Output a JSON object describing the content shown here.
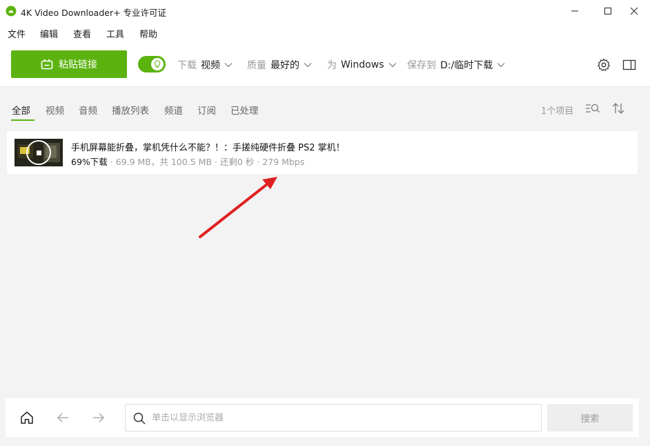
{
  "window": {
    "title": "4K Video Downloader+ 专业许可证"
  },
  "menu": [
    "文件",
    "编辑",
    "查看",
    "工具",
    "帮助"
  ],
  "toolbar": {
    "paste_label": "粘贴链接",
    "download_label": "下载",
    "download_value": "视频",
    "quality_label": "质量",
    "quality_value": "最好的",
    "for_label": "为",
    "for_value": "Windows",
    "save_label": "保存到",
    "save_value": "D:/临时下载"
  },
  "tabs": [
    "全部",
    "视频",
    "音频",
    "播放列表",
    "频道",
    "订阅",
    "已处理"
  ],
  "active_tab": "全部",
  "item_count": "1个项目",
  "download_item": {
    "title": "手机屏幕能折叠，掌机凭什么不能？！：手搓纯硬件折叠 PS2 掌机！",
    "progress_text": "69%下载",
    "progress": 0.69,
    "status": " · 69.9 MB，共 100.5 MB · 还剩0 秒 · 279 Mbps"
  },
  "bottom": {
    "search_placeholder": "单击以显示浏览器",
    "search_button": "搜索"
  },
  "colors": {
    "accent": "#5cb310",
    "annotation": "#e02020"
  }
}
